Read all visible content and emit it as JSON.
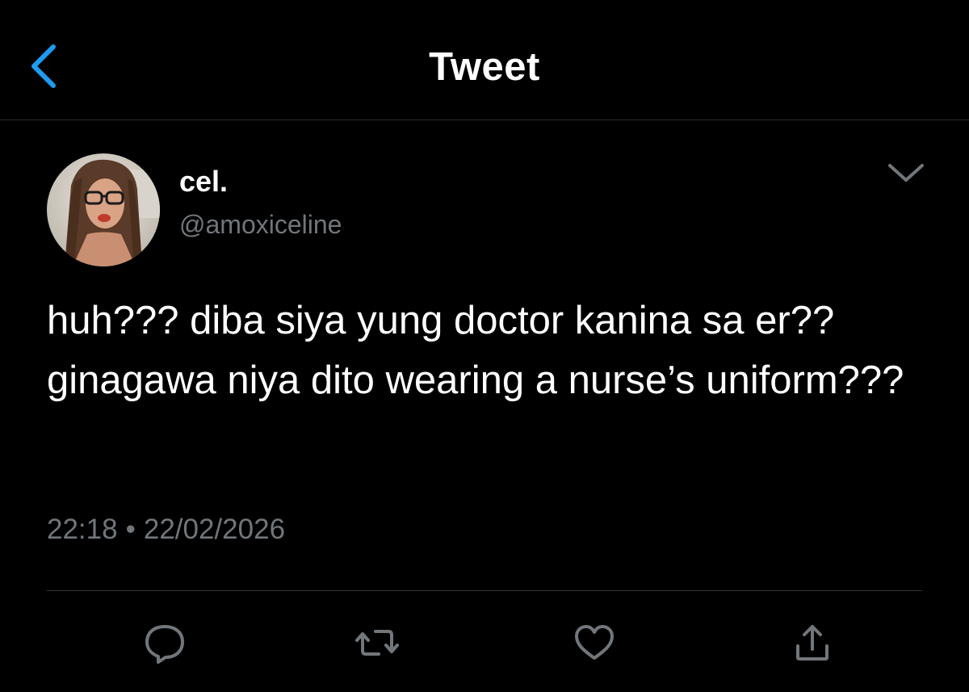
{
  "header": {
    "title": "Tweet",
    "back_icon": "chevron-left-icon",
    "accent_color": "#1d9bf0"
  },
  "tweet": {
    "author": {
      "display_name": "cel.",
      "handle": "@amoxiceline",
      "avatar": "profile-photo"
    },
    "text": "huh??? diba siya yung doctor kanina sa er?? ginagawa niya dito wearing a nurse’s uniform???",
    "time": "22:18",
    "separator": "•",
    "date": "22/02/2026"
  },
  "actions": [
    {
      "name": "reply",
      "icon": "reply-bubble-icon"
    },
    {
      "name": "retweet",
      "icon": "retweet-icon"
    },
    {
      "name": "like",
      "icon": "heart-icon"
    },
    {
      "name": "share",
      "icon": "share-icon"
    }
  ],
  "colors": {
    "background": "#000000",
    "text": "#ffffff",
    "secondary_text": "#71767b",
    "divider": "#2f3336"
  }
}
